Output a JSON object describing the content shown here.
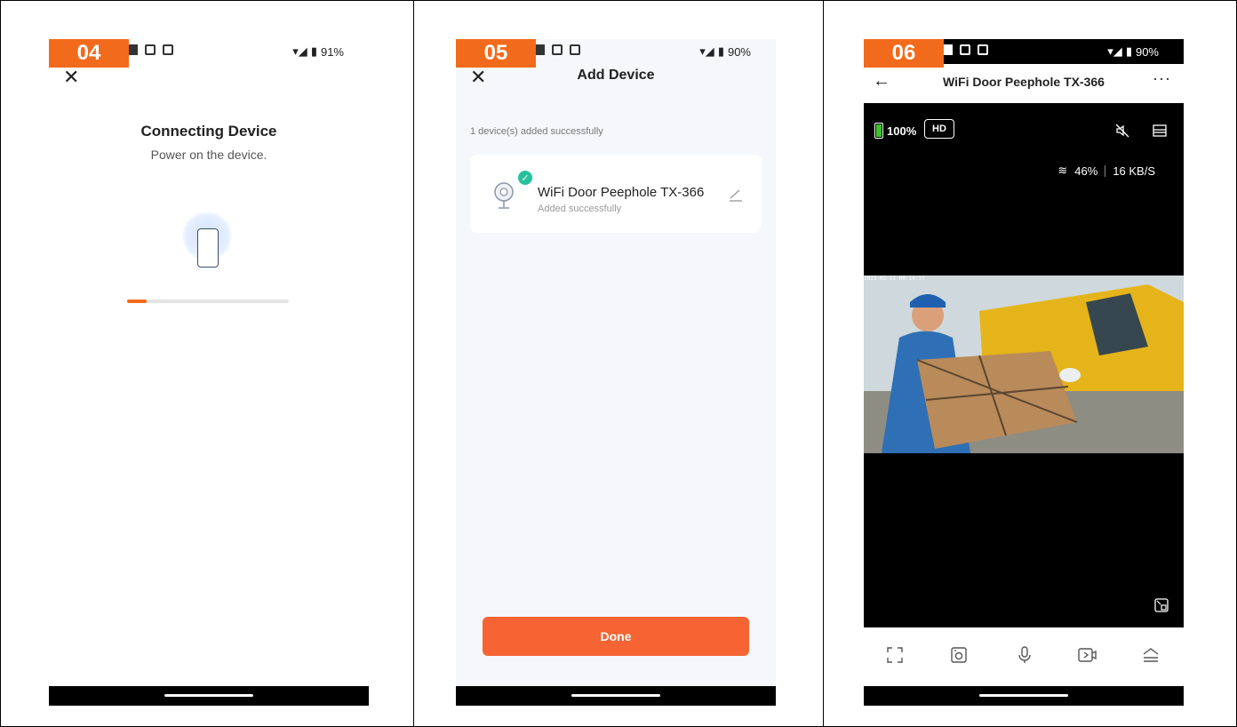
{
  "panel1": {
    "badge": "04",
    "status_battery": "91%",
    "title": "Connecting Device",
    "subtitle": "Power on the device.",
    "progress": 0.12
  },
  "panel2": {
    "badge": "05",
    "status_battery": "90%",
    "title": "Add Device",
    "added_count": "1 device(s) added successfully",
    "device_name": "WiFi Door Peephole TX-366",
    "device_status": "Added successfully",
    "done_label": "Done"
  },
  "panel3": {
    "badge": "06",
    "status_battery": "90%",
    "title": "WiFi Door Peephole TX-366",
    "battery": "100%",
    "quality": "HD",
    "signal": "46%",
    "rate": "16 KB/S",
    "timestamp": "2023-03-11 09:14:37"
  },
  "colors": {
    "accent": "#f26a1b",
    "done_button": "#f56432",
    "success": "#27c29b"
  }
}
